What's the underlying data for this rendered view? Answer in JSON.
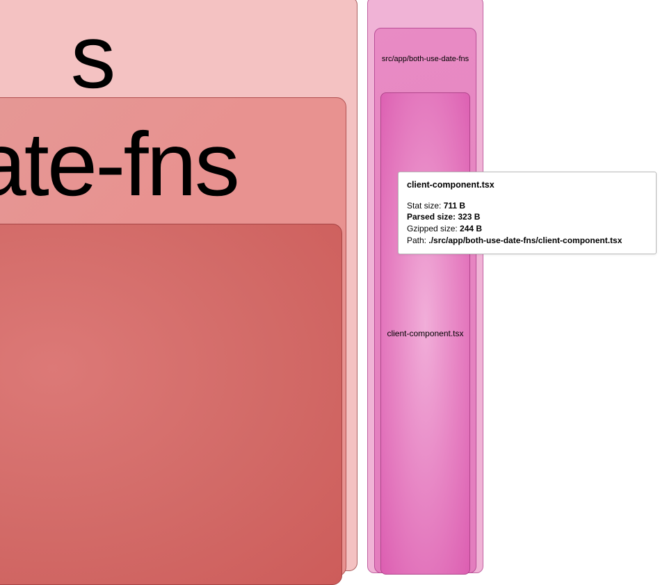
{
  "left": {
    "outer_label": "s",
    "mid_label": "date-fns",
    "inner_label": ""
  },
  "right": {
    "mid_label": "src/app/both-use-date-fns",
    "inner_label": "client-component.tsx"
  },
  "tooltip": {
    "title": "client-component.tsx",
    "stat_label": "Stat size: ",
    "stat_value": "711 B",
    "parsed_label": "Parsed size: ",
    "parsed_value": "323 B",
    "gzipped_label": "Gzipped size: ",
    "gzipped_value": "244 B",
    "path_label": "Path: ",
    "path_value": "./src/app/both-use-date-fns/client-component.tsx"
  }
}
